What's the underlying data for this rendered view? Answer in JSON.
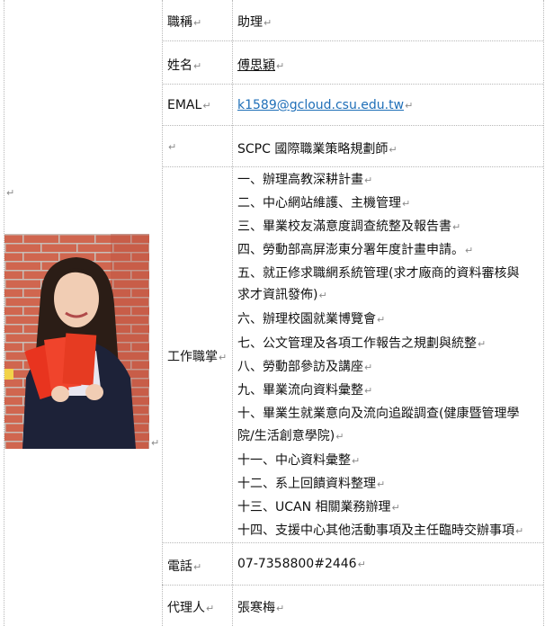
{
  "profile": {
    "title_label": "職稱",
    "title_value": "助理",
    "name_label": "姓名",
    "name_value": "傅思穎",
    "email_label": "EMAL",
    "email_value": "k1589@gcloud.csu.edu.tw",
    "cert_label": "",
    "cert_value": "SCPC 國際職業策略規劃師",
    "duties_label": "工作職掌",
    "duties": [
      "一、辦理高教深耕計畫",
      "二、中心網站維護、主機管理",
      "三、畢業校友滿意度調查統整及報告書",
      "四、勞動部高屏澎東分署年度計畫申請。",
      "五、就正修求職網系統管理(求才廠商的資料審核與",
      "求才資訊發佈)",
      "六、辦理校園就業博覽會",
      "七、公文管理及各項工作報告之規劃與統整",
      "八、勞動部參訪及講座",
      "九、畢業流向資料彙整",
      "十、畢業生就業意向及流向追蹤調查(健康暨管理學",
      "院/生活創意學院)",
      "十一、中心資料彙整",
      "十二、系上回饋資料整理",
      "十三、UCAN 相關業務辦理",
      "十四、支援中心其他活動事項及主任臨時交辦事項"
    ],
    "phone_label": "電話",
    "phone_value": "07-7358800#2446",
    "deputy_label": "代理人",
    "deputy_value": "張寒梅"
  },
  "colors": {
    "link": "#1f6fb8",
    "grid": "#b8b8b8",
    "format_mark": "#8a8a8a"
  },
  "icons": {
    "paragraph_mark": "↵"
  }
}
